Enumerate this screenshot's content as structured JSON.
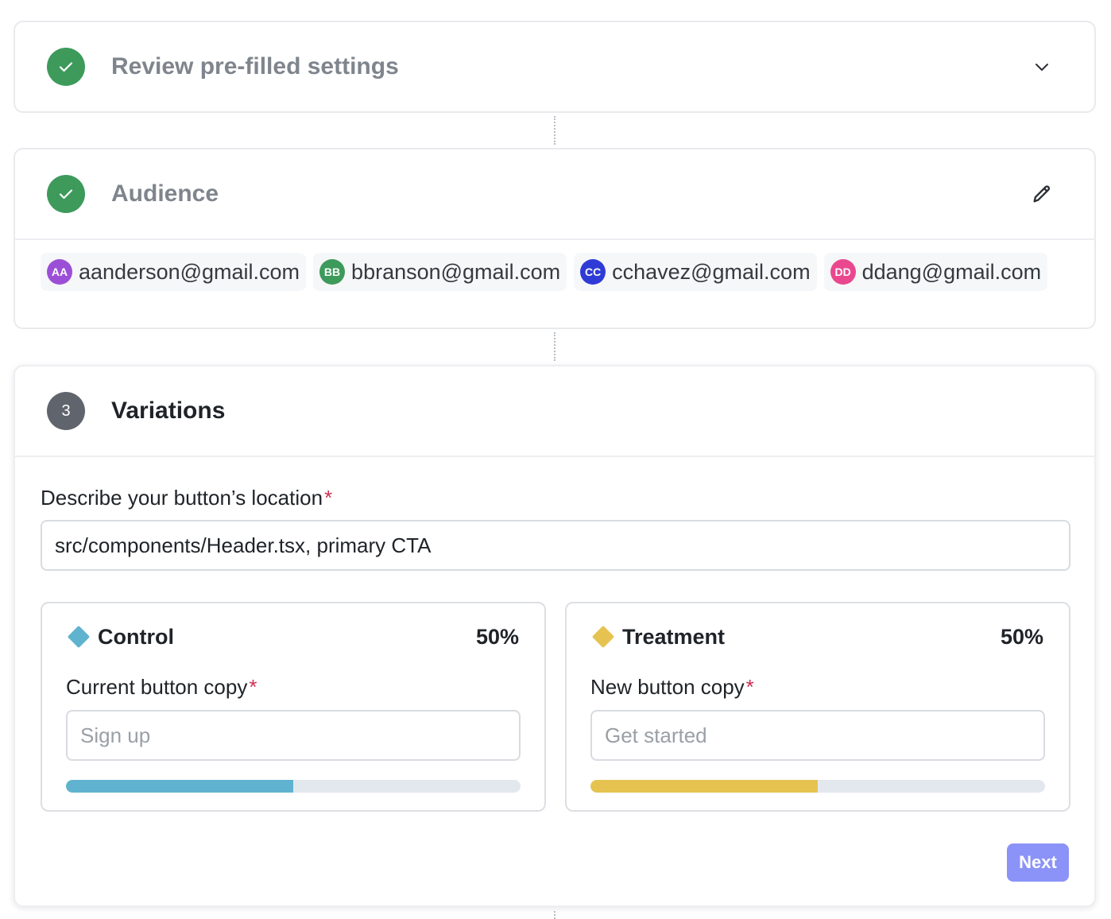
{
  "steps": {
    "review": {
      "title": "Review pre-filled settings",
      "action_icon": "chevron-down-icon"
    },
    "audience": {
      "title": "Audience",
      "action_icon": "pencil-icon",
      "members": [
        {
          "initials": "AA",
          "email": "aanderson@gmail.com",
          "color": "#9b4fd6"
        },
        {
          "initials": "BB",
          "email": "bbranson@gmail.com",
          "color": "#3d9a5b"
        },
        {
          "initials": "CC",
          "email": "cchavez@gmail.com",
          "color": "#2f3bd6"
        },
        {
          "initials": "DD",
          "email": "ddang@gmail.com",
          "color": "#e9488f"
        }
      ]
    },
    "variations": {
      "number": "3",
      "title": "Variations",
      "location": {
        "label": "Describe your button’s location",
        "required_mark": "*",
        "value": "src/components/Header.tsx, primary CTA"
      },
      "control": {
        "name": "Control",
        "percent_label": "50%",
        "split_fraction": 0.5,
        "color": "#5fb3cf",
        "copy_label": "Current button copy",
        "required_mark": "*",
        "placeholder": "Sign up"
      },
      "treatment": {
        "name": "Treatment",
        "percent_label": "50%",
        "split_fraction": 0.5,
        "color": "#e6c351",
        "copy_label": "New button copy",
        "required_mark": "*",
        "placeholder": "Get started"
      },
      "next_label": "Next"
    }
  },
  "colors": {
    "done": "#3d9a5b",
    "accent_button": "#8b93f8",
    "required": "#cf2e52"
  }
}
